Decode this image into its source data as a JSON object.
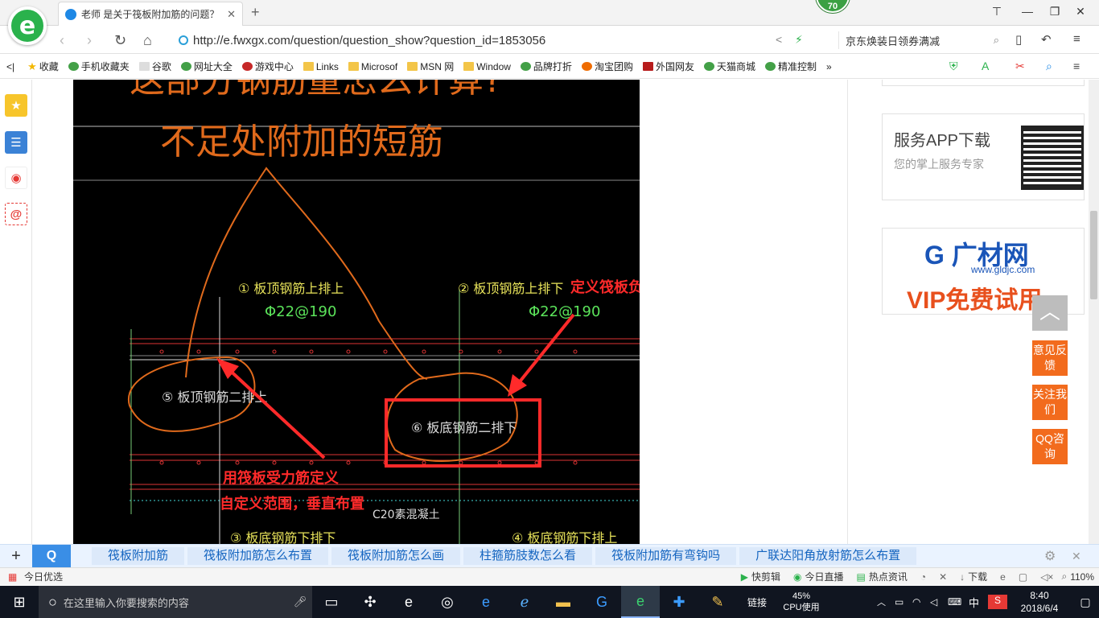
{
  "browser": {
    "tab_title": "老师 是关于筏板附加筋的问题？",
    "badge_count": "70",
    "url": "http://e.fwxgx.com/question/question_show?question_id=1853056",
    "search_text": "京东焕装日领券满减",
    "bookmarks": [
      "收藏",
      "手机收藏夹",
      "谷歌",
      "网址大全",
      "游戏中心",
      "Links",
      "Microsof",
      "MSN 网",
      "Window",
      "品牌打折",
      "淘宝团购",
      "外国网友",
      "天猫商城",
      "精准控制"
    ]
  },
  "cad": {
    "title_line1": "这部分钢筋量怎么计算?",
    "title_line2": "不足处附加的短筋",
    "labels": {
      "l1": "① 板顶钢筋上排上",
      "l1_spec": "Φ22@190",
      "l2": "② 板顶钢筋上排下",
      "l2_spec": "Φ22@190",
      "l5": "⑤ 板顶钢筋二排上",
      "l6": "⑥ 板底钢筋二排下",
      "l3": "③ 板底钢筋下排下",
      "l4": "④ 板底钢筋下排上",
      "concrete": "C20素混凝土"
    },
    "annotation_right": "定义筏板负筋，用直线绘制",
    "annotation_left_1": "用筏板受力筋定义",
    "annotation_left_2": "自定义范围，垂直布置"
  },
  "sidebar_cards": {
    "app_title": "服务APP下载",
    "app_sub": "您的掌上服务专家",
    "ad_brand": "广材网",
    "ad_url": "www.gldjc.com",
    "ad_promo": "VIP免费试用"
  },
  "float_buttons": [
    "意见反馈",
    "关注我们",
    "QQ咨询"
  ],
  "related": [
    "筏板附加筋",
    "筏板附加筋怎么布置",
    "筏板附加筋怎么画",
    "柱箍筋肢数怎么看",
    "筏板附加筋有弯钩吗",
    "广联达阳角放射筋怎么布置"
  ],
  "status": {
    "left": "今日优选",
    "items": [
      "快剪辑",
      "今日直播",
      "热点资讯",
      "下载"
    ],
    "zoom": "110%"
  },
  "taskbar": {
    "search_placeholder": "在这里输入你要搜索的内容",
    "link_label": "链接",
    "cpu": "45%",
    "cpu_label": "CPU使用",
    "ime": "中",
    "time": "8:40",
    "date": "2018/6/4"
  },
  "colors": {
    "accent": "#3a8ee6",
    "cad_orange": "#e06a1c",
    "arrow_red": "#ff2a2a",
    "cad_yellow": "#e8e35a"
  }
}
